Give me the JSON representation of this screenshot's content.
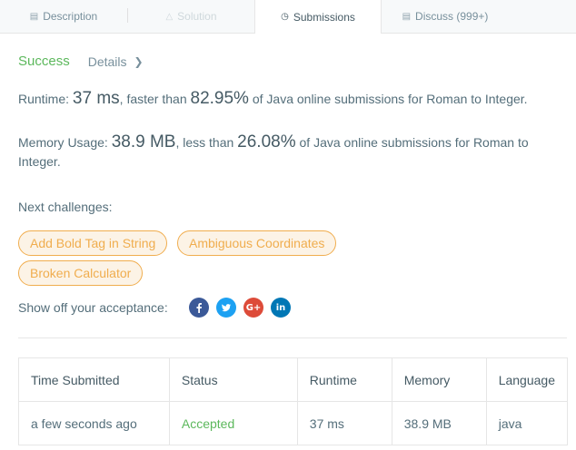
{
  "tabs": [
    {
      "label": "Description",
      "icon": "description-icon"
    },
    {
      "label": "Solution",
      "icon": "flask-icon"
    },
    {
      "label": "Submissions",
      "icon": "clock-icon"
    },
    {
      "label": "Discuss (999+)",
      "icon": "comment-icon"
    }
  ],
  "result": {
    "status": "Success",
    "details_label": "Details"
  },
  "runtime": {
    "prefix": "Runtime: ",
    "value": "37 ms",
    "mid": ", faster than ",
    "percent": "82.95%",
    "suffix": " of Java online submissions for Roman to Integer."
  },
  "memory": {
    "prefix": "Memory Usage: ",
    "value": "38.9 MB",
    "mid": ", less than ",
    "percent": "26.08%",
    "suffix": " of Java online submissions for Roman to Integer."
  },
  "next": {
    "label": "Next challenges:",
    "items": [
      "Add Bold Tag in String",
      "Ambiguous Coordinates",
      "Broken Calculator"
    ]
  },
  "share": {
    "label": "Show off your acceptance:",
    "icons": [
      "facebook-icon",
      "twitter-icon",
      "google-plus-icon",
      "linkedin-icon"
    ],
    "colors": {
      "facebook": "#3b5998",
      "twitter": "#1da1f2",
      "google_plus": "#dd4b39",
      "linkedin": "#0077b5"
    }
  },
  "table": {
    "headers": [
      "Time Submitted",
      "Status",
      "Runtime",
      "Memory",
      "Language"
    ],
    "rows": [
      [
        "a few seconds ago",
        "Accepted",
        "37 ms",
        "38.9 MB",
        "java"
      ]
    ]
  },
  "colors": {
    "success": "#5cb85c",
    "accent": "#f0ad4e"
  }
}
